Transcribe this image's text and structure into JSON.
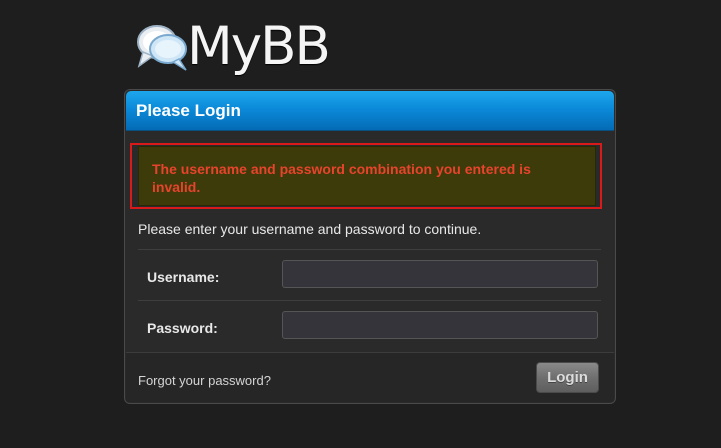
{
  "logo": {
    "text": "MyBB",
    "icon": "speech-bubbles-icon"
  },
  "panel": {
    "title": "Please Login",
    "error_message": "The username and password combination you entered is invalid.",
    "intro": "Please enter your username and password to continue."
  },
  "form": {
    "username_label": "Username:",
    "username_value": "",
    "password_label": "Password:",
    "password_value": ""
  },
  "footer": {
    "forgot_link": "Forgot your password?",
    "login_button": "Login"
  },
  "colors": {
    "header_blue": "#0b8ad9",
    "error_border": "#d91a1a",
    "error_text": "#e8432c",
    "error_background": "#3d3b0a",
    "page_background": "#1e1e1e"
  }
}
